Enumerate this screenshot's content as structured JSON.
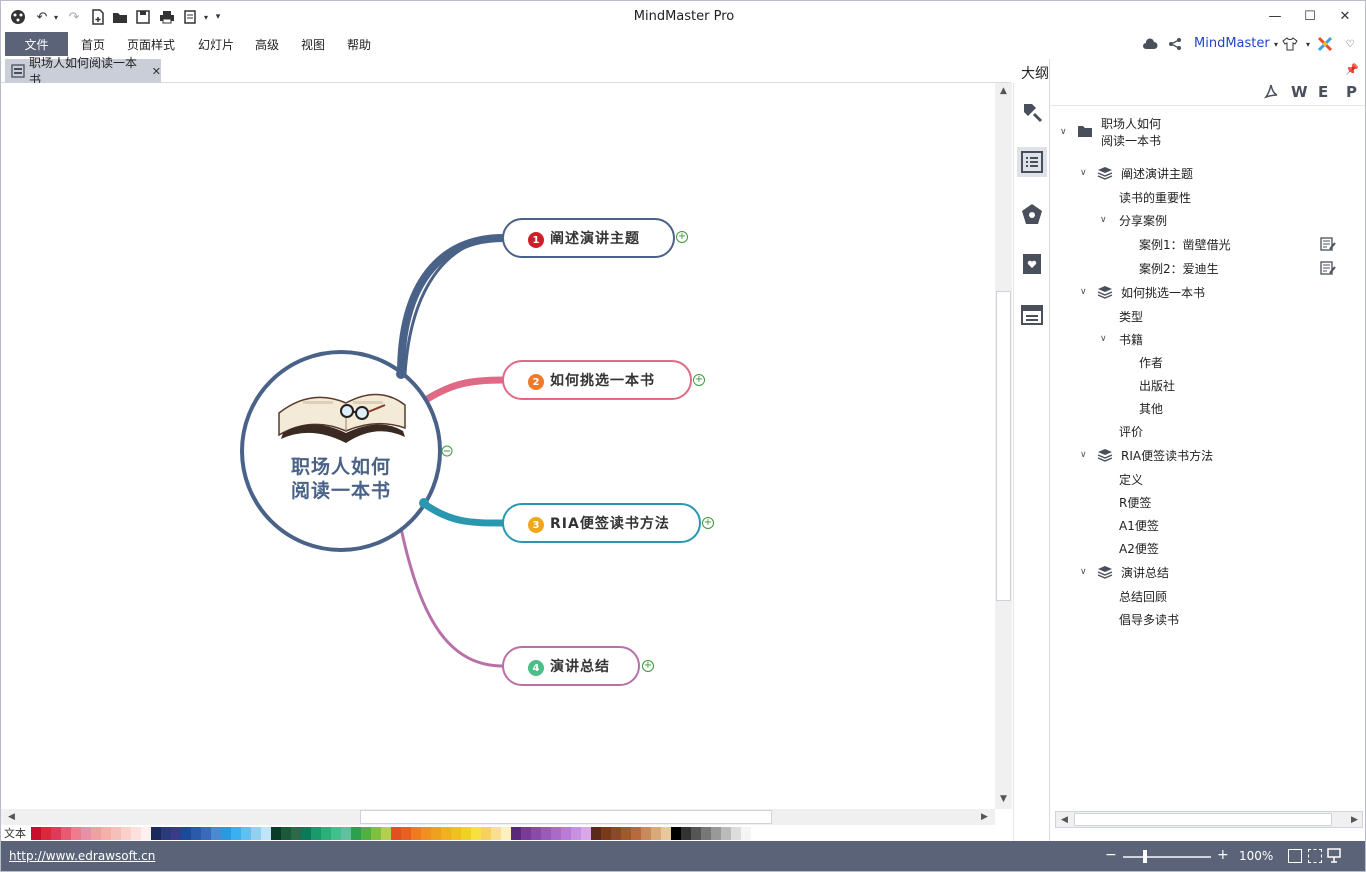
{
  "app": {
    "title": "MindMaster Pro"
  },
  "menu": {
    "file": "文件",
    "items": [
      "首页",
      "页面样式",
      "幻灯片",
      "高级",
      "视图",
      "帮助"
    ],
    "brand": "MindMaster"
  },
  "tab": {
    "label": "职场人如何阅读一本书",
    "close": "✕"
  },
  "map": {
    "central": {
      "line1": "职场人如何",
      "line2": "阅读一本书"
    },
    "topics": [
      {
        "num": "1",
        "label": "阐述演讲主题",
        "color": "#4a6288",
        "badge": "#cc1f2a"
      },
      {
        "num": "2",
        "label": "如何挑选一本书",
        "color": "#e06a86",
        "badge": "#f07a2a"
      },
      {
        "num": "3",
        "label": "RIA便签读书方法",
        "color": "#2a97b0",
        "badge": "#f0a81a"
      },
      {
        "num": "4",
        "label": "演讲总结",
        "color": "#b870a8",
        "badge": "#4bbf8a"
      }
    ]
  },
  "palette": {
    "label": "文本"
  },
  "outline": {
    "title": "大纲",
    "export": [
      "W",
      "E",
      "P"
    ],
    "root": {
      "line1": "职场人如何",
      "line2": "阅读一本书"
    },
    "items": [
      {
        "text": "阐述演讲主题",
        "level": 1
      },
      {
        "text": "读书的重要性",
        "level": 2
      },
      {
        "text": "分享案例",
        "level": 2
      },
      {
        "text": "案例1：凿壁借光",
        "level": 3
      },
      {
        "text": "案例2：爱迪生",
        "level": 3
      },
      {
        "text": "如何挑选一本书",
        "level": 1
      },
      {
        "text": "类型",
        "level": 2
      },
      {
        "text": "书籍",
        "level": 2
      },
      {
        "text": "作者",
        "level": 3
      },
      {
        "text": "出版社",
        "level": 3
      },
      {
        "text": "其他",
        "level": 3
      },
      {
        "text": "评价",
        "level": 2
      },
      {
        "text": "RIA便签读书方法",
        "level": 1
      },
      {
        "text": "定义",
        "level": 2
      },
      {
        "text": "R便签",
        "level": 2
      },
      {
        "text": "A1便签",
        "level": 2
      },
      {
        "text": "A2便签",
        "level": 2
      },
      {
        "text": "演讲总结",
        "level": 1
      },
      {
        "text": "总结回顾",
        "level": 2
      },
      {
        "text": "倡导多读书",
        "level": 2
      }
    ]
  },
  "status": {
    "url": "http://www.edrawsoft.cn",
    "zoom": "100%",
    "minus": "−",
    "plus": "+"
  }
}
